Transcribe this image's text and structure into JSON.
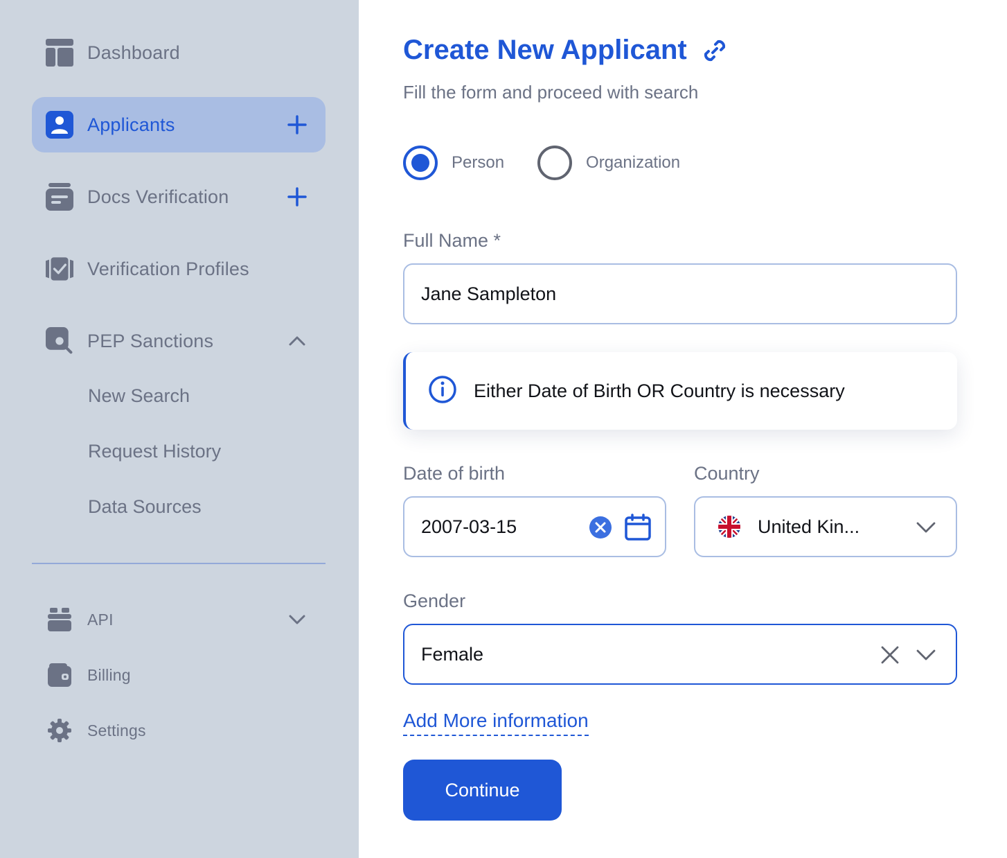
{
  "sidebar": {
    "items": [
      {
        "label": "Dashboard",
        "icon": "dashboard-icon"
      },
      {
        "label": "Applicants",
        "icon": "user-icon",
        "active": true,
        "action": "plus-icon"
      },
      {
        "label": "Docs Verification",
        "icon": "docs-icon",
        "action": "plus-icon"
      },
      {
        "label": "Verification Profiles",
        "icon": "check-card-icon"
      },
      {
        "label": "PEP Sanctions",
        "icon": "search-icon",
        "expanded": true,
        "action": "chevron-up-icon"
      }
    ],
    "pep_sub_items": [
      "New Search",
      "Request History",
      "Data Sources"
    ],
    "bottom_items": [
      {
        "label": "API",
        "icon": "api-icon",
        "action": "chevron-down-icon"
      },
      {
        "label": "Billing",
        "icon": "wallet-icon"
      },
      {
        "label": "Settings",
        "icon": "gear-icon"
      }
    ]
  },
  "form": {
    "title": "Create New Applicant",
    "subtitle": "Fill the form and proceed with search",
    "type_options": [
      "Person",
      "Organization"
    ],
    "selected_type": "Person",
    "full_name_label": "Full Name *",
    "full_name_value": "Jane Sampleton",
    "info_message": "Either Date of Birth OR Country is necessary",
    "dob_label": "Date of birth",
    "dob_value": "2007-03-15",
    "country_label": "Country",
    "country_value": "United Kin...",
    "gender_label": "Gender",
    "gender_value": "Female",
    "add_more_label": "Add More information",
    "continue_label": "Continue"
  },
  "colors": {
    "accent": "#1f57d6",
    "sidebar_bg": "#cdd5df",
    "active_bg": "#a9bde3",
    "muted_text": "#6b7285"
  }
}
